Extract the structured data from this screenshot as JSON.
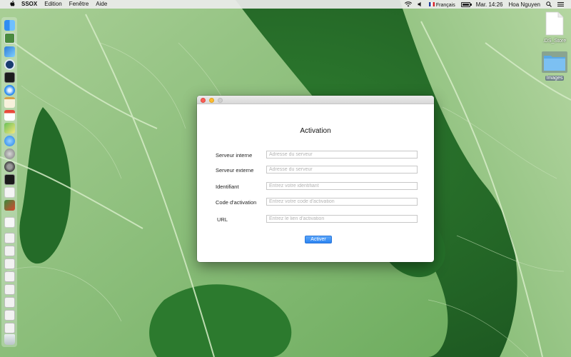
{
  "menubar": {
    "app_name": "SSOX",
    "menus": [
      "Edition",
      "Fenêtre",
      "Aide"
    ],
    "input_language": "Français",
    "clock": "Mar. 14:26",
    "user": "Hoa Nguyen",
    "icons": [
      "apple-icon",
      "wifi-icon",
      "volume-icon",
      "flag-icon",
      "battery-icon",
      "search-icon",
      "list-icon"
    ]
  },
  "desktop": {
    "items": [
      {
        "label": ".DS_Store",
        "icon": "file-icon",
        "selected": false
      },
      {
        "label": "Images",
        "icon": "folder-icon",
        "selected": true
      }
    ]
  },
  "dock": {
    "icons": [
      "finder-icon",
      "xcode-icon",
      "pen-tool-icon",
      "safari-compass-icon",
      "terminal-icon",
      "safari-icon",
      "notes-icon",
      "calendar-icon",
      "maps-icon",
      "app-store-icon",
      "launchpad-icon",
      "system-preferences-icon",
      "activity-monitor-icon",
      "document-icon",
      "chart-icon",
      "text-file-icon",
      "window-icon",
      "window-icon",
      "window-icon",
      "window-icon",
      "window-icon",
      "window-icon",
      "window-icon",
      "window-icon",
      "trash-icon"
    ]
  },
  "window": {
    "title": "Activation",
    "fields": [
      {
        "label": "Serveur interne",
        "placeholder": "Adresse du serveur",
        "value": ""
      },
      {
        "label": "Serveur externe",
        "placeholder": "Adresse du serveur",
        "value": ""
      },
      {
        "label": "Identifiant",
        "placeholder": "Entrez votre identifiant",
        "value": ""
      },
      {
        "label": "Code d'activation",
        "placeholder": "Entrez votre code d'activation",
        "value": ""
      },
      {
        "label": "URL",
        "placeholder": "Entrez le lien d'activation",
        "value": ""
      }
    ],
    "button_label": "Activer"
  },
  "colors": {
    "accent": "#2d84f2",
    "close": "#fc5f57",
    "minimize": "#fdbd2e",
    "zoom": "#d0d0d0"
  }
}
